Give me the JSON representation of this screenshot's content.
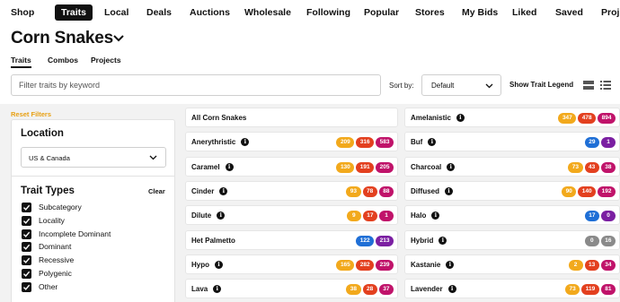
{
  "topnav": {
    "items": [
      "Shop",
      "Traits",
      "Local",
      "Deals",
      "Auctions",
      "Wholesale",
      "Following",
      "Popular",
      "Stores",
      "My Bids",
      "Liked",
      "Saved",
      "Proj"
    ],
    "active_index": 1
  },
  "page": {
    "title": "Corn Snakes"
  },
  "tabs": [
    "Traits",
    "Combos",
    "Projects"
  ],
  "filter": {
    "search_placeholder": "Filter traits by keyword",
    "sort_label": "Sort by:",
    "sort_value": "Default",
    "legend_label": "Show Trait Legend"
  },
  "sidebar": {
    "reset_label": "Reset Filters",
    "location_title": "Location",
    "location_value": "US & Canada",
    "trait_types_title": "Trait Types",
    "clear_label": "Clear",
    "trait_types": [
      "Subcategory",
      "Locality",
      "Incomplete Dominant",
      "Dominant",
      "Recessive",
      "Polygenic",
      "Other"
    ]
  },
  "colors": {
    "yellow": "#f2a91c",
    "red": "#e3401f",
    "magenta": "#c0136a",
    "blue": "#1f6fd6",
    "purple": "#7b1fa2",
    "gray": "#8a8a8a",
    "accent": "#e8a013"
  },
  "traits_left": [
    {
      "name": "All Corn Snakes",
      "info": false,
      "counts": []
    },
    {
      "name": "Anerythristic",
      "info": true,
      "counts": [
        {
          "v": "209",
          "c": "yellow"
        },
        {
          "v": "316",
          "c": "red"
        },
        {
          "v": "583",
          "c": "magenta"
        }
      ]
    },
    {
      "name": "Caramel",
      "info": true,
      "counts": [
        {
          "v": "130",
          "c": "yellow"
        },
        {
          "v": "191",
          "c": "red"
        },
        {
          "v": "205",
          "c": "magenta"
        }
      ]
    },
    {
      "name": "Cinder",
      "info": true,
      "counts": [
        {
          "v": "93",
          "c": "yellow"
        },
        {
          "v": "78",
          "c": "red"
        },
        {
          "v": "88",
          "c": "magenta"
        }
      ]
    },
    {
      "name": "Dilute",
      "info": true,
      "counts": [
        {
          "v": "9",
          "c": "yellow"
        },
        {
          "v": "17",
          "c": "red"
        },
        {
          "v": "1",
          "c": "magenta"
        }
      ]
    },
    {
      "name": "Het Palmetto",
      "info": false,
      "counts": [
        {
          "v": "122",
          "c": "blue"
        },
        {
          "v": "213",
          "c": "purple"
        }
      ]
    },
    {
      "name": "Hypo",
      "info": true,
      "counts": [
        {
          "v": "165",
          "c": "yellow"
        },
        {
          "v": "282",
          "c": "red"
        },
        {
          "v": "239",
          "c": "magenta"
        }
      ]
    },
    {
      "name": "Lava",
      "info": true,
      "counts": [
        {
          "v": "38",
          "c": "yellow"
        },
        {
          "v": "28",
          "c": "red"
        },
        {
          "v": "37",
          "c": "magenta"
        }
      ]
    }
  ],
  "traits_right": [
    {
      "name": "Amelanistic",
      "info": true,
      "counts": [
        {
          "v": "347",
          "c": "yellow"
        },
        {
          "v": "478",
          "c": "red"
        },
        {
          "v": "894",
          "c": "magenta"
        }
      ]
    },
    {
      "name": "Buf",
      "info": true,
      "counts": [
        {
          "v": "29",
          "c": "blue"
        },
        {
          "v": "1",
          "c": "purple"
        }
      ]
    },
    {
      "name": "Charcoal",
      "info": true,
      "counts": [
        {
          "v": "73",
          "c": "yellow"
        },
        {
          "v": "43",
          "c": "red"
        },
        {
          "v": "38",
          "c": "magenta"
        }
      ]
    },
    {
      "name": "Diffused",
      "info": true,
      "counts": [
        {
          "v": "90",
          "c": "yellow"
        },
        {
          "v": "140",
          "c": "red"
        },
        {
          "v": "192",
          "c": "magenta"
        }
      ]
    },
    {
      "name": "Halo",
      "info": true,
      "counts": [
        {
          "v": "17",
          "c": "blue"
        },
        {
          "v": "0",
          "c": "purple"
        }
      ]
    },
    {
      "name": "Hybrid",
      "info": true,
      "counts": [
        {
          "v": "0",
          "c": "gray"
        },
        {
          "v": "16",
          "c": "gray"
        }
      ]
    },
    {
      "name": "Kastanie",
      "info": true,
      "counts": [
        {
          "v": "2",
          "c": "yellow"
        },
        {
          "v": "13",
          "c": "red"
        },
        {
          "v": "34",
          "c": "magenta"
        }
      ]
    },
    {
      "name": "Lavender",
      "info": true,
      "counts": [
        {
          "v": "73",
          "c": "yellow"
        },
        {
          "v": "119",
          "c": "red"
        },
        {
          "v": "81",
          "c": "magenta"
        }
      ]
    }
  ]
}
